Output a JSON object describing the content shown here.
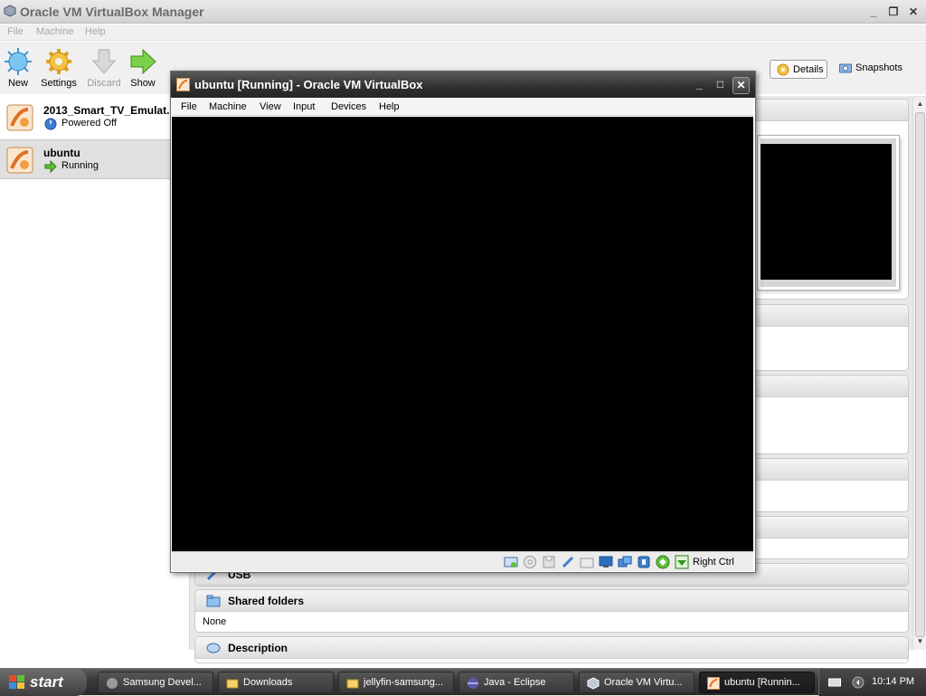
{
  "manager": {
    "title": "Oracle VM VirtualBox Manager",
    "menu": [
      "File",
      "Machine",
      "Help"
    ],
    "toolbar": {
      "new": "New",
      "settings": "Settings",
      "discard": "Discard",
      "show": "Show",
      "details": "Details",
      "snapshots": "Snapshots"
    },
    "vms": [
      {
        "name": "2013_Smart_TV_Emulat...",
        "state": "Powered Off"
      },
      {
        "name": "ubuntu",
        "state": "Running"
      }
    ],
    "sections": {
      "usb": "USB",
      "shared_folders": "Shared folders",
      "shared_folders_value": "None",
      "description": "Description"
    }
  },
  "vm_window": {
    "title": "ubuntu [Running] - Oracle VM VirtualBox",
    "menu": [
      "File",
      "Machine",
      "View",
      "Input",
      "Devices",
      "Help"
    ],
    "host_key": "Right Ctrl"
  },
  "taskbar": {
    "start": "start",
    "tasks": [
      "Samsung Devel...",
      "Downloads",
      "jellyfin-samsung...",
      "Java - Eclipse",
      "Oracle VM Virtu...",
      "ubuntu [Runnin..."
    ],
    "clock": "10:14 PM"
  },
  "colors": {
    "titlebar_dark": "#2f2f2f",
    "selection": "#e0e0e0",
    "screen": "#000000"
  }
}
